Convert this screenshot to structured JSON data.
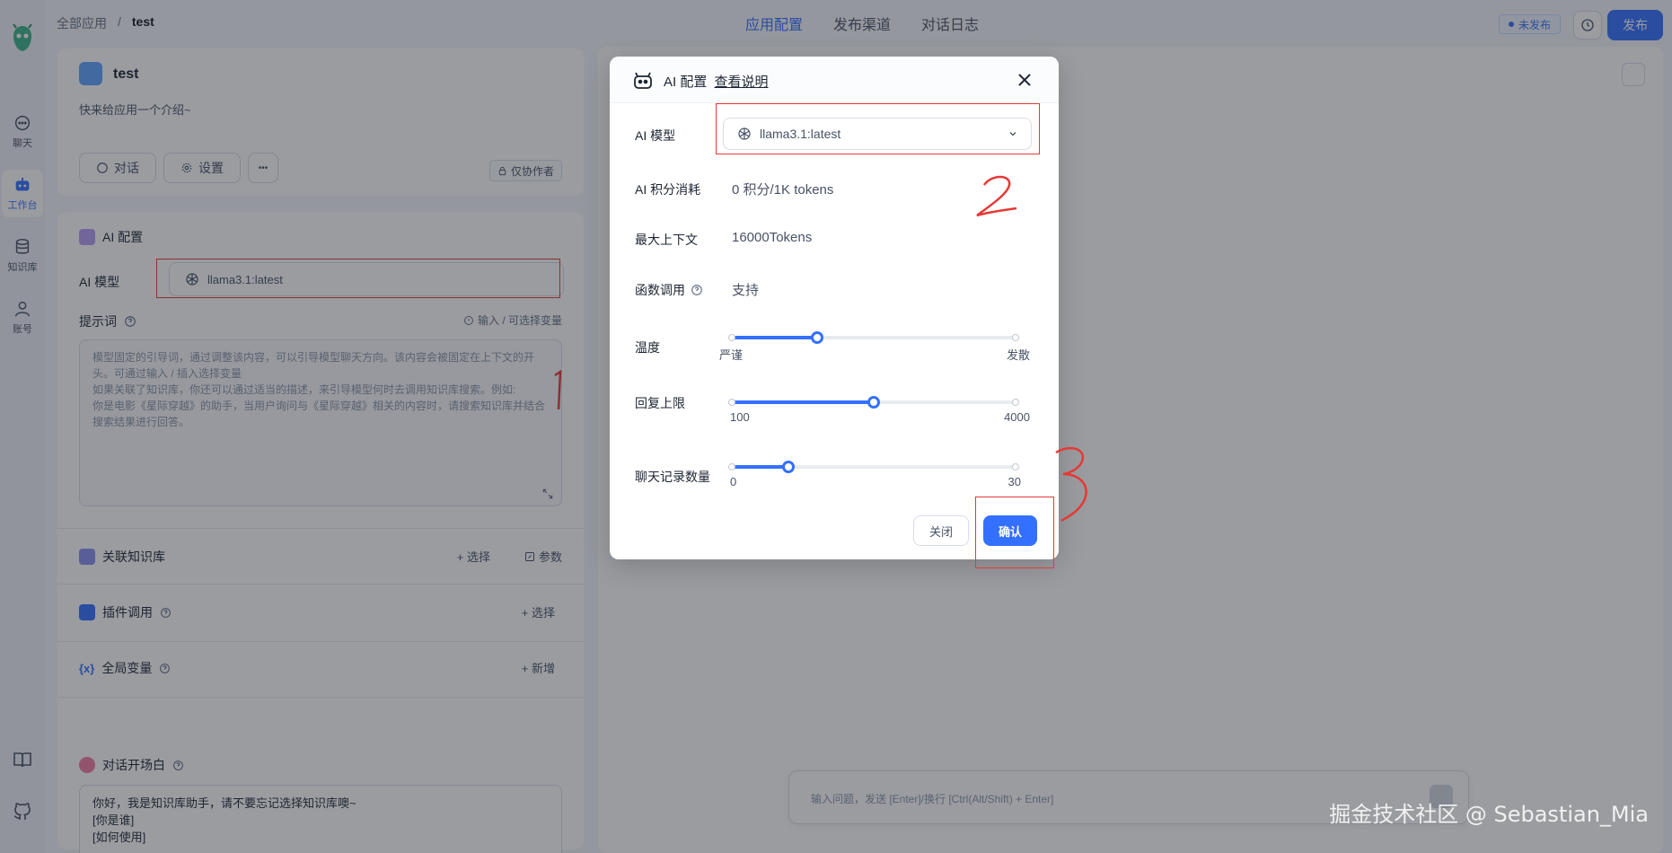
{
  "nav": {
    "items": [
      {
        "label": "聊天",
        "icon": "chat-icon",
        "active": false
      },
      {
        "label": "工作台",
        "icon": "robot-icon",
        "active": true
      },
      {
        "label": "知识库",
        "icon": "database-icon",
        "active": false
      },
      {
        "label": "账号",
        "icon": "user-icon",
        "active": false
      }
    ],
    "bottom_icons": [
      "book-icon",
      "github-icon"
    ]
  },
  "breadcrumb": {
    "root": "全部应用",
    "sep": "/",
    "current": "test"
  },
  "header_tabs": [
    {
      "label": "应用配置",
      "active": true
    },
    {
      "label": "发布渠道",
      "active": false
    },
    {
      "label": "对话日志",
      "active": false
    }
  ],
  "header": {
    "status": "未发布",
    "publish": "发布"
  },
  "app": {
    "name": "test",
    "intro": "快来给应用一个介绍~",
    "chat_btn": "对话",
    "settings_btn": "设置",
    "more_btn": "•••",
    "collab_tag": "仅协作者"
  },
  "config": {
    "section_title": "AI 配置",
    "model_label": "AI 模型",
    "model_value": "llama3.1:latest",
    "prompt_label": "提示词",
    "prompt_hint": "输入 / 可选择变量",
    "prompt_placeholder": [
      "模型固定的引导词，通过调整该内容，可以引导模型聊天方向。该内容会被固定在上下文的开",
      "头。可通过输入 / 插入选择变量",
      "如果关联了知识库，你还可以通过适当的描述，来引导模型何时去调用知识库搜索。例如:",
      "你是电影《星际穿越》的助手，当用户询问与《星际穿越》相关的内容时，请搜索知识库并结合",
      "搜索结果进行回答。"
    ],
    "kb": {
      "title": "关联知识库",
      "select": "+ 选择",
      "params": "参数"
    },
    "plugin": {
      "title": "插件调用",
      "select": "+ 选择"
    },
    "vars": {
      "title": "全局变量",
      "add": "+ 新增"
    },
    "welcome": {
      "title": "对话开场白",
      "lines": [
        "你好，我是知识库助手，请不要忘记选择知识库噢~",
        "[你是谁]",
        "[如何使用]"
      ]
    }
  },
  "chat": {
    "placeholder": "输入问题，发送 [Enter]/换行 [Ctrl(Alt/Shift) + Enter]"
  },
  "modal": {
    "title": "AI 配置",
    "help": "查看说明",
    "model_label": "AI 模型",
    "model_value": "llama3.1:latest",
    "points_label": "AI 积分消耗",
    "points_value": "0 积分/1K tokens",
    "context_label": "最大上下文",
    "context_value": "16000Tokens",
    "function_label": "函数调用",
    "function_value": "支持",
    "temperature": {
      "label": "温度",
      "min_label": "严谨",
      "max_label": "发散",
      "fraction": 0.3
    },
    "max_reply": {
      "label": "回复上限",
      "min": "100",
      "max": "4000",
      "fraction": 0.5
    },
    "history": {
      "label": "聊天记录数量",
      "min": "0",
      "max": "30",
      "fraction": 0.2
    },
    "cancel": "关闭",
    "confirm": "确认"
  },
  "annotations": [
    "1",
    "2",
    "3"
  ],
  "watermark": "掘金技术社区 @ Sebastian_Mia",
  "colors": {
    "accent": "#3370ff",
    "annotation": "#e53935"
  }
}
